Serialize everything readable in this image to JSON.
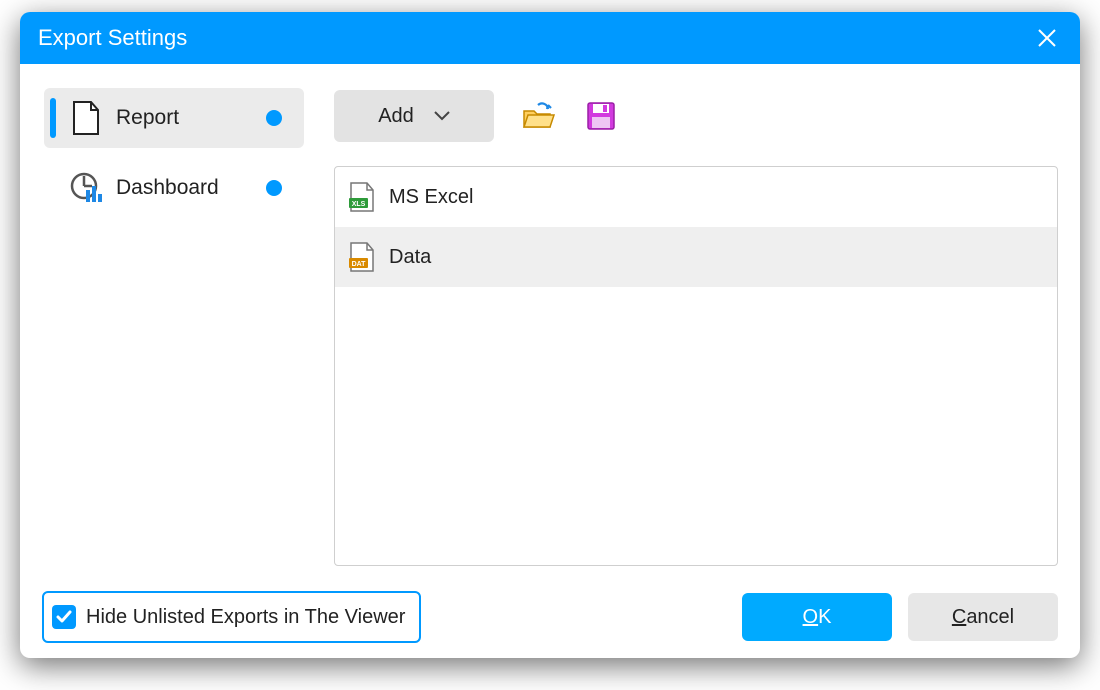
{
  "dialog": {
    "title": "Export Settings"
  },
  "sidebar": {
    "items": [
      {
        "label": "Report",
        "icon": "document-icon",
        "active": true,
        "indicator": true
      },
      {
        "label": "Dashboard",
        "icon": "dashboard-icon",
        "active": false,
        "indicator": true
      }
    ]
  },
  "toolbar": {
    "add_label": "Add"
  },
  "export_list": {
    "items": [
      {
        "label": "MS Excel",
        "file_tag": "XLS",
        "tag_color": "#2e9b3a",
        "selected": false
      },
      {
        "label": "Data",
        "file_tag": "DAT",
        "tag_color": "#d98a00",
        "selected": true
      }
    ]
  },
  "footer": {
    "checkbox_label": "Hide Unlisted Exports in The Viewer",
    "checkbox_checked": true,
    "ok_label": "OK",
    "cancel_label": "Cancel"
  },
  "colors": {
    "accent": "#0099ff"
  }
}
